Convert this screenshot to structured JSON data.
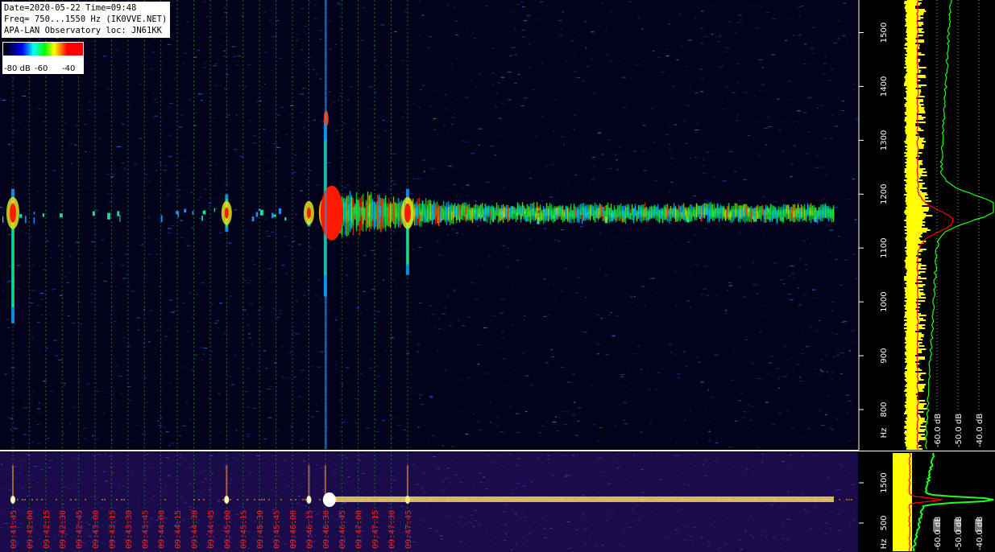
{
  "header": {
    "line1": "Date=2020-05-22 Time=09:48",
    "line2": "Freq= 750...1550 Hz (IK0VVE.NET)",
    "line3": "APA-LAN Observatory loc: JN61KK"
  },
  "color_scale": {
    "labels": [
      "-80 dB",
      "-60",
      "-40"
    ],
    "colors": [
      "#000000",
      "#0000ff",
      "#00ffff",
      "#00ff00",
      "#ffff00",
      "#ff0000"
    ]
  },
  "chart_data": [
    {
      "type": "heatmap",
      "description_kind": "spectrogram",
      "y_unit": "Hz",
      "ylim": [
        750,
        1550
      ],
      "y_ticks": [
        800,
        900,
        1000,
        1100,
        1200,
        1300,
        1400,
        1500
      ],
      "y_tick_labels": [
        "800",
        "900",
        "1000",
        "1100",
        "1200",
        "1300",
        "1400",
        "1500"
      ],
      "y_axis_unit_label": "Hz",
      "x_tick_labels": [
        "09:41:45",
        "09:42:00",
        "09:42:15",
        "09:42:30",
        "09:42:45",
        "09:43:00",
        "09:43:15",
        "09:43:30",
        "09:43:45",
        "09:44:00",
        "09:44:15",
        "09:44:30",
        "09:44:45",
        "09:45:00",
        "09:45:15",
        "09:45:30",
        "09:45:45",
        "09:46:00",
        "09:46:15",
        "09:46:30",
        "09:46:45",
        "09:47:00",
        "09:47:15",
        "09:47:30",
        "09:47:45"
      ],
      "xlim": [
        "09:41:42",
        "09:48:00"
      ],
      "signal_band_hz": [
        1130,
        1200
      ],
      "bursts": [
        {
          "time": "09:41:45",
          "f_low": 960,
          "f_high": 1210,
          "level_db": -40
        },
        {
          "time": "09:45:00",
          "f_low": 1130,
          "f_high": 1200,
          "level_db": -45
        },
        {
          "time": "09:46:15",
          "f_low": 1140,
          "f_high": 1170,
          "level_db": -45
        },
        {
          "time": "09:46:30",
          "f_low": 1010,
          "f_high": 1340,
          "level_db": -40
        },
        {
          "time": "09:47:45",
          "f_low": 1050,
          "f_high": 1210,
          "level_db": -40
        }
      ]
    },
    {
      "type": "line",
      "description_kind": "spectrum-profile",
      "x_tick_labels": [
        "-60.0 dB",
        "-50.0 dB",
        "-40.0 dB"
      ],
      "xlim": [
        -60,
        -40
      ],
      "ylim": [
        750,
        1550
      ],
      "series": [
        {
          "color": "#ffff00",
          "style": "noise-band"
        },
        {
          "color": "#ff0000",
          "peak_hz": 1150
        },
        {
          "color": "#00ff00",
          "peak_hz": 1175
        }
      ]
    },
    {
      "type": "heatmap",
      "description_kind": "wide-spectrogram",
      "y_tick_labels": [
        "1500",
        "500"
      ],
      "y_axis_unit_label": "Hz",
      "x_tick_labels": [
        "-60.0 dB",
        "-50.0 dB",
        "-40.0 dB"
      ],
      "signal_line_hz": 1150
    }
  ]
}
